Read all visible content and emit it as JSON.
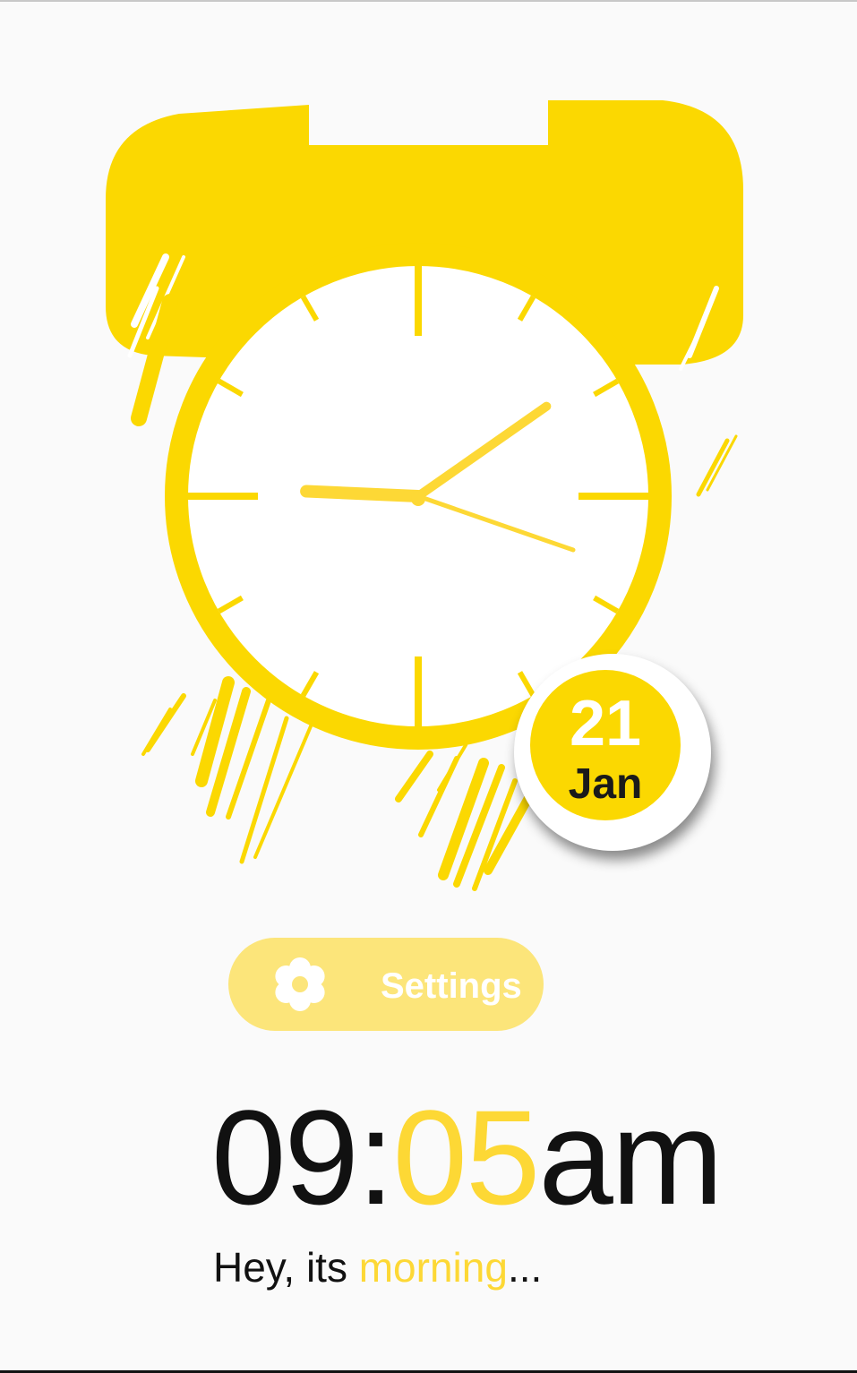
{
  "colors": {
    "accent": "#fbd801",
    "accent_light": "#fce57a",
    "minutes": "#fdd835",
    "text": "#111111",
    "background": "#fafafa"
  },
  "clock": {
    "hour": 9,
    "minute": 5
  },
  "date_badge": {
    "day": "21",
    "month": "Jan"
  },
  "settings": {
    "icon": "gear-icon",
    "label": "Settings"
  },
  "time": {
    "hours": "09",
    "separator": ":",
    "minutes": "05",
    "ampm": "am"
  },
  "greeting": {
    "prefix": "Hey, its ",
    "highlight": "morning",
    "suffix": "..."
  }
}
